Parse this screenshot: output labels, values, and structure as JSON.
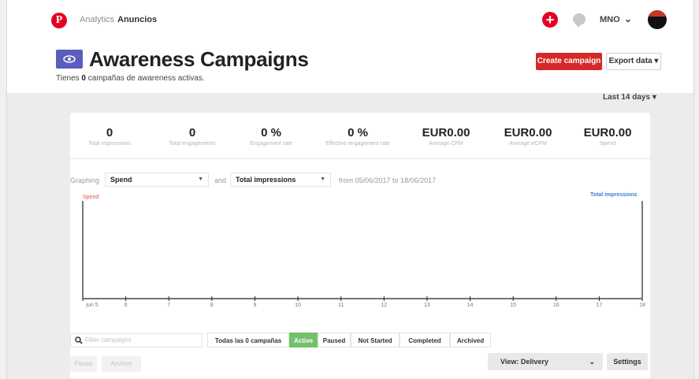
{
  "nav": {
    "logo": "P",
    "analytics": "Analytics",
    "anuncios": "Anuncios",
    "create_icon": "plus-icon",
    "messages_icon": "chat-icon",
    "user": "MNO"
  },
  "header": {
    "icon": "eye-icon",
    "title": "Awareness Campaigns",
    "subtitle_prefix": "Tienes ",
    "subtitle_count": "0",
    "subtitle_suffix": " campañas de awareness activas.",
    "create_button": "Create campaign",
    "export_button": "Export data ▾"
  },
  "date_range": "Last 14 days ▾",
  "stats": [
    {
      "value": "0",
      "label": "Total impressions"
    },
    {
      "value": "0",
      "label": "Total engagements"
    },
    {
      "value": "0 %",
      "label": "Engagement rate"
    },
    {
      "value": "0 %",
      "label": "Effective engagement rate"
    },
    {
      "value": "EUR0.00",
      "label": "Average CPM"
    },
    {
      "value": "EUR0.00",
      "label": "Average eCPM"
    },
    {
      "value": "EUR0.00",
      "label": "Spend"
    }
  ],
  "graph": {
    "graphing_label": "Graphing",
    "metric1": "Spend",
    "and_label": "and",
    "metric2": "Total impressions",
    "range_text": "from 05/06/2017 to 18/06/2017",
    "left_axis_title": "Spend",
    "right_axis_title": "Total impressions",
    "x_ticks": [
      "jun 5",
      "6",
      "7",
      "8",
      "9",
      "10",
      "11",
      "12",
      "13",
      "14",
      "15",
      "16",
      "17",
      "18"
    ],
    "line_color": "#222222"
  },
  "filters": {
    "search_placeholder": "Filter campaigns",
    "tabs": [
      "Todas las 0 campañas",
      "Active",
      "Paused",
      "Not Started",
      "Completed",
      "Archived"
    ],
    "active_tab": "Active",
    "active_color": "#73c16a"
  },
  "actions": {
    "pause": "Pause",
    "archive": "Archive",
    "view": "View: Delivery",
    "settings": "Settings"
  }
}
